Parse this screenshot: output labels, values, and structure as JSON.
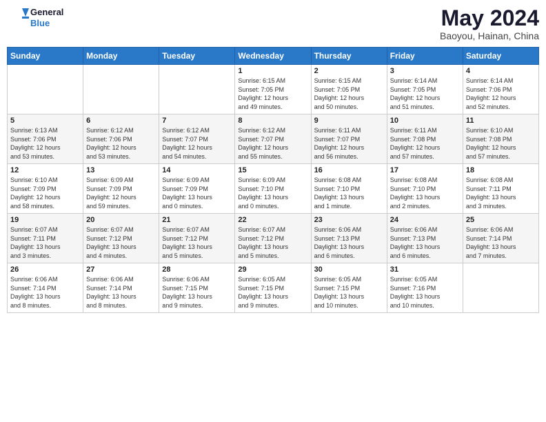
{
  "header": {
    "logo_line1": "General",
    "logo_line2": "Blue",
    "month_year": "May 2024",
    "location": "Baoyou, Hainan, China"
  },
  "days_of_week": [
    "Sunday",
    "Monday",
    "Tuesday",
    "Wednesday",
    "Thursday",
    "Friday",
    "Saturday"
  ],
  "weeks": [
    [
      {
        "day": "",
        "info": ""
      },
      {
        "day": "",
        "info": ""
      },
      {
        "day": "",
        "info": ""
      },
      {
        "day": "1",
        "info": "Sunrise: 6:15 AM\nSunset: 7:05 PM\nDaylight: 12 hours\nand 49 minutes."
      },
      {
        "day": "2",
        "info": "Sunrise: 6:15 AM\nSunset: 7:05 PM\nDaylight: 12 hours\nand 50 minutes."
      },
      {
        "day": "3",
        "info": "Sunrise: 6:14 AM\nSunset: 7:05 PM\nDaylight: 12 hours\nand 51 minutes."
      },
      {
        "day": "4",
        "info": "Sunrise: 6:14 AM\nSunset: 7:06 PM\nDaylight: 12 hours\nand 52 minutes."
      }
    ],
    [
      {
        "day": "5",
        "info": "Sunrise: 6:13 AM\nSunset: 7:06 PM\nDaylight: 12 hours\nand 53 minutes."
      },
      {
        "day": "6",
        "info": "Sunrise: 6:12 AM\nSunset: 7:06 PM\nDaylight: 12 hours\nand 53 minutes."
      },
      {
        "day": "7",
        "info": "Sunrise: 6:12 AM\nSunset: 7:07 PM\nDaylight: 12 hours\nand 54 minutes."
      },
      {
        "day": "8",
        "info": "Sunrise: 6:12 AM\nSunset: 7:07 PM\nDaylight: 12 hours\nand 55 minutes."
      },
      {
        "day": "9",
        "info": "Sunrise: 6:11 AM\nSunset: 7:07 PM\nDaylight: 12 hours\nand 56 minutes."
      },
      {
        "day": "10",
        "info": "Sunrise: 6:11 AM\nSunset: 7:08 PM\nDaylight: 12 hours\nand 57 minutes."
      },
      {
        "day": "11",
        "info": "Sunrise: 6:10 AM\nSunset: 7:08 PM\nDaylight: 12 hours\nand 57 minutes."
      }
    ],
    [
      {
        "day": "12",
        "info": "Sunrise: 6:10 AM\nSunset: 7:09 PM\nDaylight: 12 hours\nand 58 minutes."
      },
      {
        "day": "13",
        "info": "Sunrise: 6:09 AM\nSunset: 7:09 PM\nDaylight: 12 hours\nand 59 minutes."
      },
      {
        "day": "14",
        "info": "Sunrise: 6:09 AM\nSunset: 7:09 PM\nDaylight: 13 hours\nand 0 minutes."
      },
      {
        "day": "15",
        "info": "Sunrise: 6:09 AM\nSunset: 7:10 PM\nDaylight: 13 hours\nand 0 minutes."
      },
      {
        "day": "16",
        "info": "Sunrise: 6:08 AM\nSunset: 7:10 PM\nDaylight: 13 hours\nand 1 minute."
      },
      {
        "day": "17",
        "info": "Sunrise: 6:08 AM\nSunset: 7:10 PM\nDaylight: 13 hours\nand 2 minutes."
      },
      {
        "day": "18",
        "info": "Sunrise: 6:08 AM\nSunset: 7:11 PM\nDaylight: 13 hours\nand 3 minutes."
      }
    ],
    [
      {
        "day": "19",
        "info": "Sunrise: 6:07 AM\nSunset: 7:11 PM\nDaylight: 13 hours\nand 3 minutes."
      },
      {
        "day": "20",
        "info": "Sunrise: 6:07 AM\nSunset: 7:12 PM\nDaylight: 13 hours\nand 4 minutes."
      },
      {
        "day": "21",
        "info": "Sunrise: 6:07 AM\nSunset: 7:12 PM\nDaylight: 13 hours\nand 5 minutes."
      },
      {
        "day": "22",
        "info": "Sunrise: 6:07 AM\nSunset: 7:12 PM\nDaylight: 13 hours\nand 5 minutes."
      },
      {
        "day": "23",
        "info": "Sunrise: 6:06 AM\nSunset: 7:13 PM\nDaylight: 13 hours\nand 6 minutes."
      },
      {
        "day": "24",
        "info": "Sunrise: 6:06 AM\nSunset: 7:13 PM\nDaylight: 13 hours\nand 6 minutes."
      },
      {
        "day": "25",
        "info": "Sunrise: 6:06 AM\nSunset: 7:14 PM\nDaylight: 13 hours\nand 7 minutes."
      }
    ],
    [
      {
        "day": "26",
        "info": "Sunrise: 6:06 AM\nSunset: 7:14 PM\nDaylight: 13 hours\nand 8 minutes."
      },
      {
        "day": "27",
        "info": "Sunrise: 6:06 AM\nSunset: 7:14 PM\nDaylight: 13 hours\nand 8 minutes."
      },
      {
        "day": "28",
        "info": "Sunrise: 6:06 AM\nSunset: 7:15 PM\nDaylight: 13 hours\nand 9 minutes."
      },
      {
        "day": "29",
        "info": "Sunrise: 6:05 AM\nSunset: 7:15 PM\nDaylight: 13 hours\nand 9 minutes."
      },
      {
        "day": "30",
        "info": "Sunrise: 6:05 AM\nSunset: 7:15 PM\nDaylight: 13 hours\nand 10 minutes."
      },
      {
        "day": "31",
        "info": "Sunrise: 6:05 AM\nSunset: 7:16 PM\nDaylight: 13 hours\nand 10 minutes."
      },
      {
        "day": "",
        "info": ""
      }
    ]
  ]
}
